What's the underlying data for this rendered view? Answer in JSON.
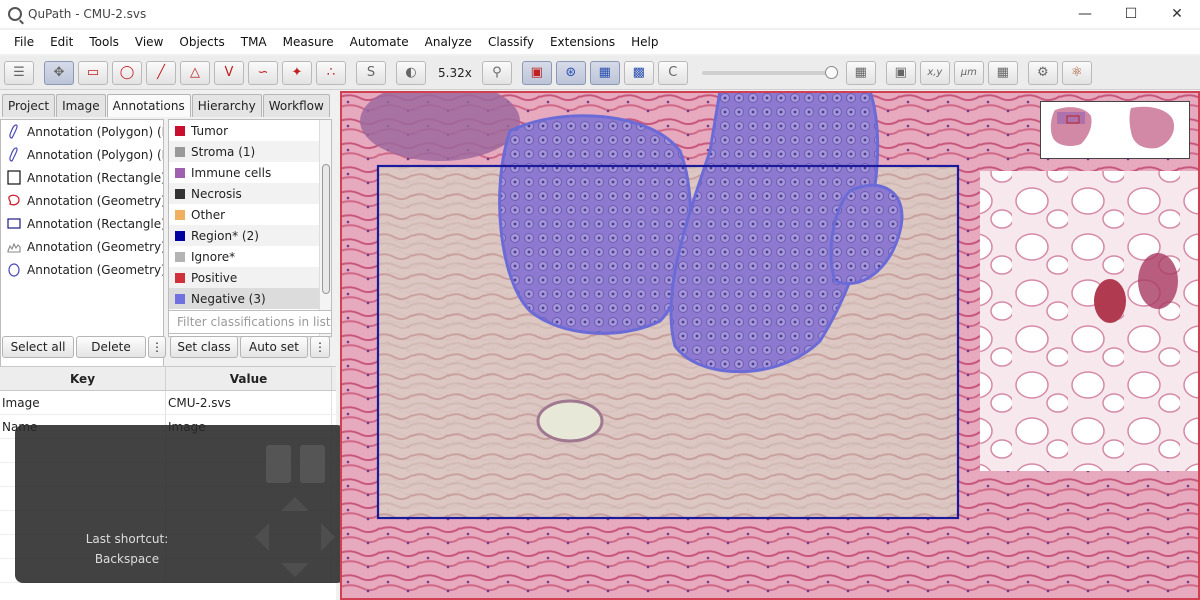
{
  "window": {
    "title": "QuPath - CMU-2.svs"
  },
  "menu": [
    "File",
    "Edit",
    "Tools",
    "View",
    "Objects",
    "TMA",
    "Measure",
    "Automate",
    "Analyze",
    "Classify",
    "Extensions",
    "Help"
  ],
  "toolbar": {
    "magnification": "5.32x"
  },
  "tabs": [
    "Project",
    "Image",
    "Annotations",
    "Hierarchy",
    "Workflow"
  ],
  "annotations": [
    {
      "label": "Annotation (Polygon) (Neg",
      "icon": "polygon-icon"
    },
    {
      "label": "Annotation (Polygon) (Neg",
      "icon": "polygon-icon"
    },
    {
      "label": "Annotation (Rectangle) (R",
      "icon": "rectangle-icon"
    },
    {
      "label": "Annotation (Geometry)",
      "icon": "geometry-icon"
    },
    {
      "label": "Annotation (Rectangle) (R",
      "icon": "rectangle-icon"
    },
    {
      "label": "Annotation (Geometry) (S",
      "icon": "geometry-icon"
    },
    {
      "label": "Annotation (Geometry) (N",
      "icon": "geometry-icon"
    }
  ],
  "classes": [
    {
      "name": "Tumor",
      "color": "#c8102e"
    },
    {
      "name": "Stroma (1)",
      "color": "#999999"
    },
    {
      "name": "Immune cells",
      "color": "#a05fb0"
    },
    {
      "name": "Necrosis",
      "color": "#333333"
    },
    {
      "name": "Other",
      "color": "#f0b060"
    },
    {
      "name": "Region* (2)",
      "color": "#0000a0"
    },
    {
      "name": "Ignore*",
      "color": "#b4b4b4"
    },
    {
      "name": "Positive",
      "color": "#d0303a"
    },
    {
      "name": "Negative (3)",
      "color": "#7070e0"
    }
  ],
  "filter_placeholder": "Filter classifications in list",
  "buttons": {
    "select_all": "Select all",
    "delete": "Delete",
    "more": "⋮",
    "set_class": "Set class",
    "auto_set": "Auto set"
  },
  "table": {
    "headers": [
      "Key",
      "Value"
    ],
    "rows": [
      {
        "key": "Image",
        "value": "CMU-2.svs"
      },
      {
        "key": "Name",
        "value": "Image"
      }
    ]
  },
  "overlay": {
    "label": "Last shortcut:",
    "key": "Backspace"
  },
  "toolbar_labels": {
    "xy": "x,y",
    "um": "μm"
  }
}
